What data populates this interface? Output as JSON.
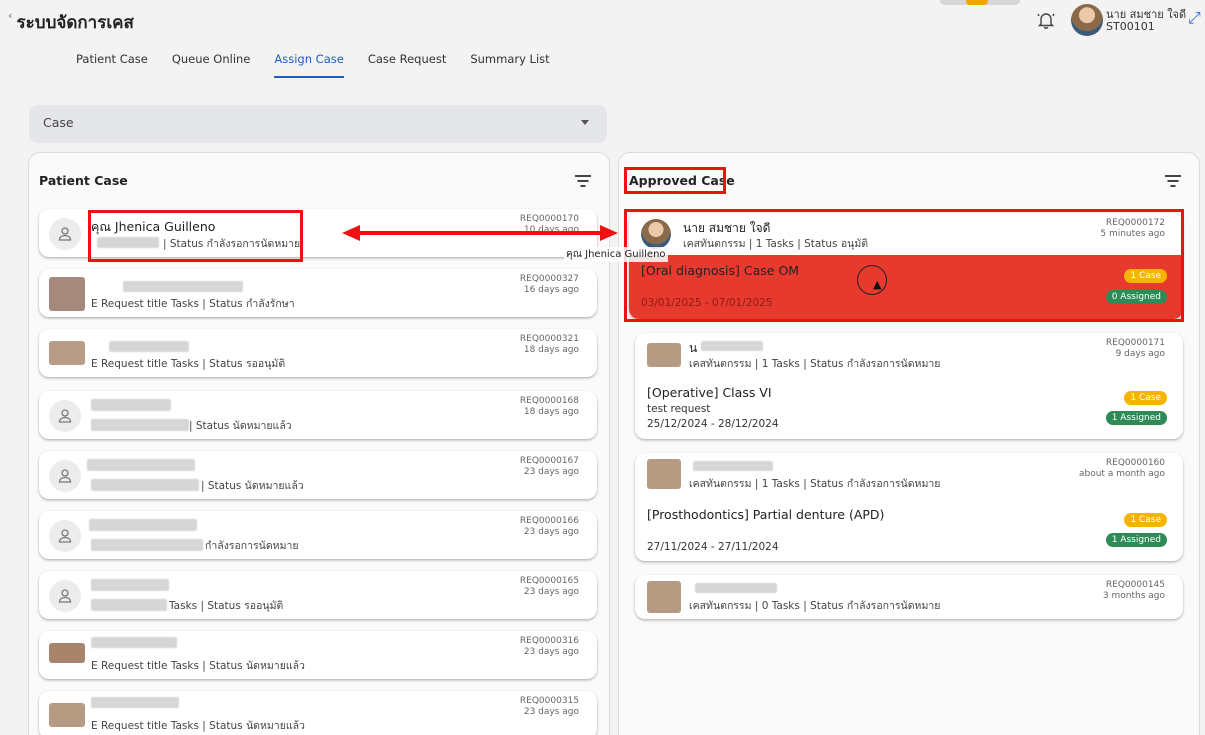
{
  "app": {
    "title": "ระบบจัดการเคส"
  },
  "user": {
    "name": "นาย สมชาย ใจดี",
    "id": "ST00101"
  },
  "tabs": [
    {
      "label": "Patient Case"
    },
    {
      "label": "Queue Online"
    },
    {
      "label": "Assign Case"
    },
    {
      "label": "Case Request"
    },
    {
      "label": "Summary List"
    }
  ],
  "active_tab": "Assign Case",
  "case_select": {
    "value": "Case"
  },
  "left_panel": {
    "title": "Patient Case",
    "items": [
      {
        "name": "คุณ Jhenica Guilleno",
        "status": "| Status กำลังรอการนัดหมาย",
        "req": "REQ0000170",
        "ago": "10 days ago"
      },
      {
        "name": "",
        "status": "E Request title Tasks | Status กำลังรักษา",
        "req": "REQ0000327",
        "ago": "16 days ago"
      },
      {
        "name": "",
        "status": "E Request title Tasks | Status รออนุมัติ",
        "req": "REQ0000321",
        "ago": "18 days ago"
      },
      {
        "name": "",
        "status": "| Status นัดหมายแล้ว",
        "req": "REQ0000168",
        "ago": "18 days ago"
      },
      {
        "name": "",
        "status": "| Status นัดหมายแล้ว",
        "req": "REQ0000167",
        "ago": "23 days ago"
      },
      {
        "name": "",
        "status": "กำลังรอการนัดหมาย",
        "req": "REQ0000166",
        "ago": "23 days ago"
      },
      {
        "name": "",
        "status": "Tasks | Status รออนุมัติ",
        "req": "REQ0000165",
        "ago": "23 days ago"
      },
      {
        "name": "",
        "status": "E Request title Tasks | Status นัดหมายแล้ว",
        "req": "REQ0000316",
        "ago": "23 days ago"
      },
      {
        "name": "",
        "status": "E Request title Tasks | Status นัดหมายแล้ว",
        "req": "REQ0000315",
        "ago": "23 days ago"
      }
    ]
  },
  "right_panel": {
    "title": "Approved Case",
    "cards": [
      {
        "name": "นาย สมชาย ใจดี",
        "status": "เคสทันตกรรม | 1 Tasks | Status อนุมัติ",
        "req": "REQ0000172",
        "ago": "5 minutes ago",
        "case_title": "[Oral diagnosis] Case OM",
        "note": "",
        "dates": "03/01/2025 - 07/01/2025",
        "case_badge": "1 Case",
        "assigned_badge": "0 Assigned"
      },
      {
        "name": "น",
        "status": "เคสทันตกรรม | 1 Tasks | Status กำลังรอการนัดหมาย",
        "req": "REQ0000171",
        "ago": "9 days ago",
        "case_title": "[Operative] Class VI",
        "note": "test request",
        "dates": "25/12/2024 - 28/12/2024",
        "case_badge": "1 Case",
        "assigned_badge": "1 Assigned"
      },
      {
        "name": "",
        "status": "เคสทันตกรรม | 1 Tasks | Status กำลังรอการนัดหมาย",
        "req": "REQ0000160",
        "ago": "about a month ago",
        "case_title": "[Prosthodontics] Partial denture (APD)",
        "note": "",
        "dates": "27/11/2024 - 27/11/2024",
        "case_badge": "1 Case",
        "assigned_badge": "1 Assigned"
      },
      {
        "name": "",
        "status": "เคสทันตกรรม | 0 Tasks | Status กำลังรอการนัดหมาย",
        "req": "REQ0000145",
        "ago": "3 months ago"
      }
    ]
  },
  "drag_tooltip": "คุณ Jhenica Guilleno",
  "colors": {
    "accent": "#1d5fbf",
    "highlight": "#e8392e",
    "annotation": "#ee1111",
    "badge_case": "#f5b400",
    "badge_assigned": "#2e8b57"
  }
}
